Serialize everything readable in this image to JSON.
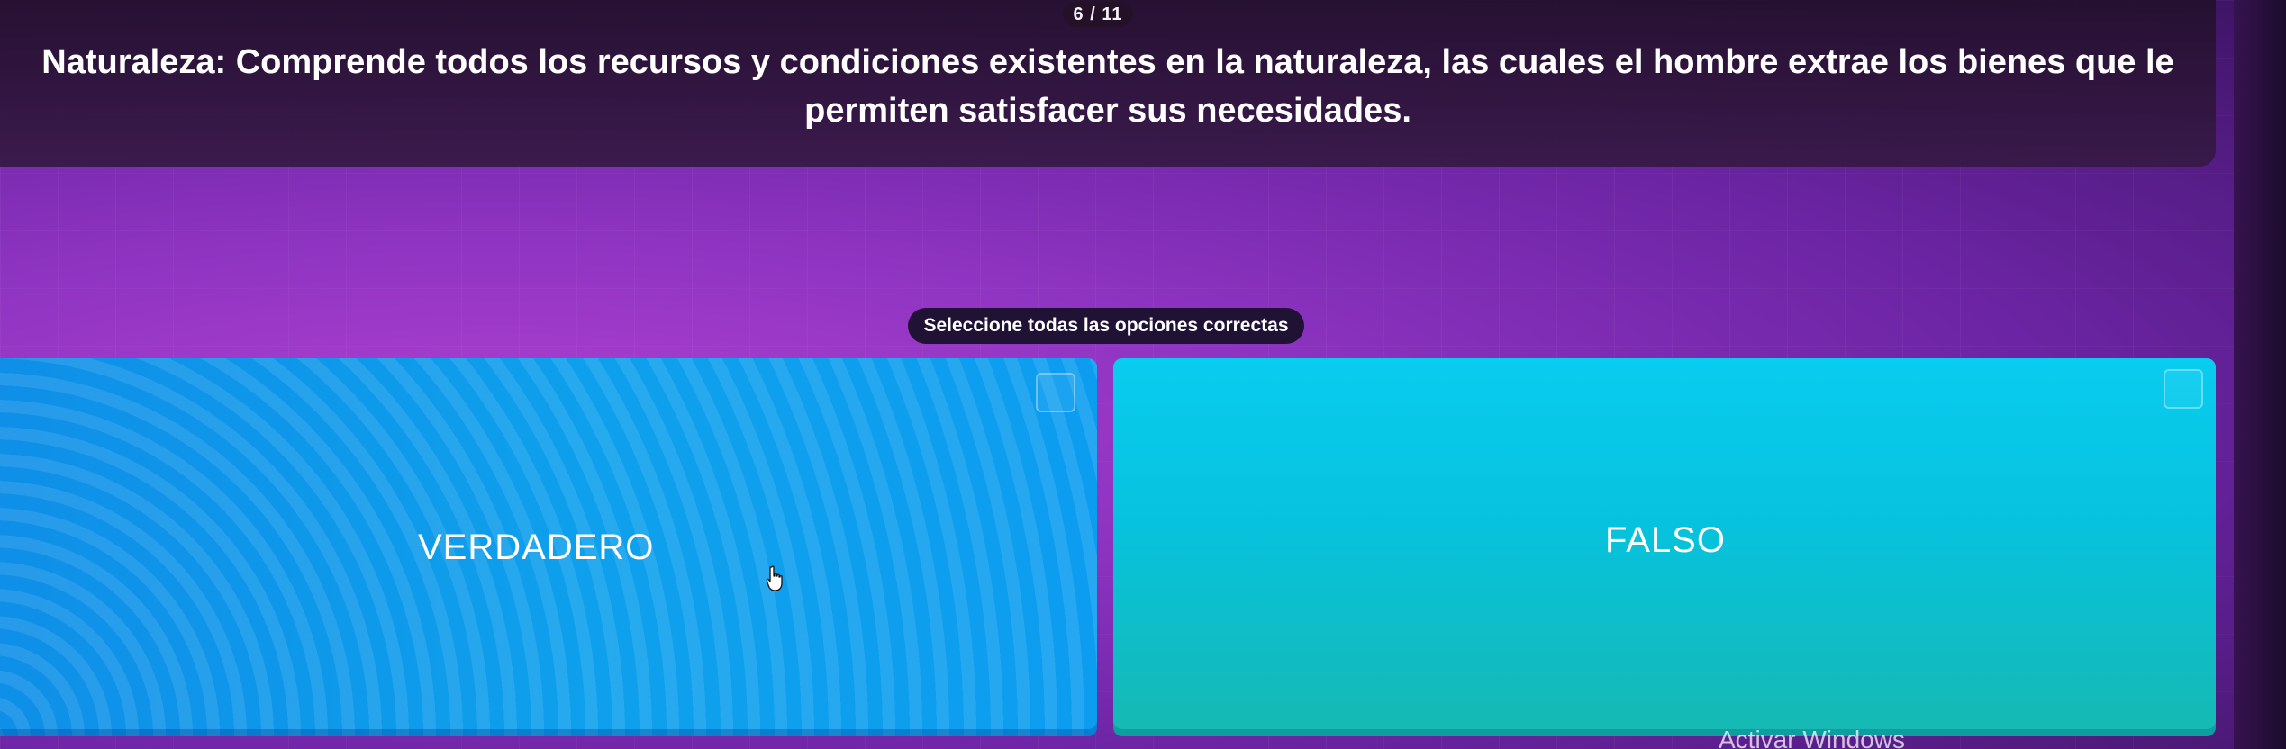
{
  "header": {
    "progress": "6 / 11",
    "question": "Naturaleza: Comprende todos los recursos y condiciones existentes en la naturaleza, las cuales el hombre extrae los bienes que le permiten satisfacer sus necesidades."
  },
  "instruction": "Seleccione todas las opciones correctas",
  "options": [
    {
      "label": "VERDADERO",
      "color": "#0f9aec"
    },
    {
      "label": "FALSO",
      "color": "#08c6e4"
    }
  ],
  "system": {
    "watermark": "Activar Windows"
  },
  "icons": {
    "cursor": "hand-pointer-icon",
    "checkbox": "checkbox-icon"
  }
}
